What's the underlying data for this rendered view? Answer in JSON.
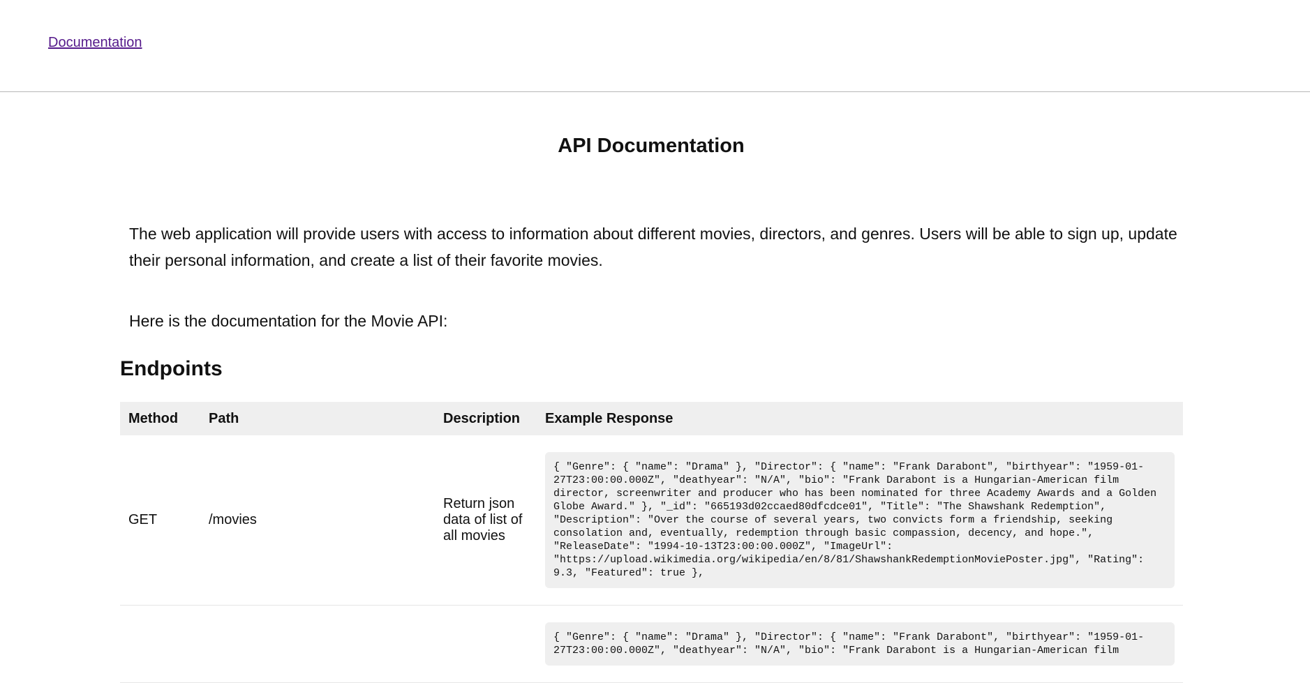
{
  "nav": {
    "documentation_link": "Documentation"
  },
  "page": {
    "title": "API Documentation",
    "intro": "The web application will provide users with access to information about different movies, directors, and genres. Users will be able to sign up, update their personal information, and create a list of their favorite movies.",
    "lead": "Here is the documentation for the Movie API:",
    "section_heading": "Endpoints"
  },
  "table": {
    "headers": [
      "Method",
      "Path",
      "Description",
      "Example Response"
    ],
    "rows": [
      {
        "method": "GET",
        "path": "/movies",
        "description": "Return json data of list of all movies",
        "example": "{ \"Genre\": { \"name\": \"Drama\" }, \"Director\": { \"name\": \"Frank Darabont\", \"birthyear\": \"1959-01-27T23:00:00.000Z\", \"deathyear\": \"N/A\", \"bio\": \"Frank Darabont is a Hungarian-American film director, screenwriter and producer who has been nominated for three Academy Awards and a Golden Globe Award.\" }, \"_id\": \"665193d02ccaed80dfcdce01\", \"Title\": \"The Shawshank Redemption\", \"Description\": \"Over the course of several years, two convicts form a friendship, seeking consolation and, eventually, redemption through basic compassion, decency, and hope.\", \"ReleaseDate\": \"1994-10-13T23:00:00.000Z\", \"ImageUrl\": \"https://upload.wikimedia.org/wikipedia/en/8/81/ShawshankRedemptionMoviePoster.jpg\", \"Rating\": 9.3, \"Featured\": true },"
      },
      {
        "method": "",
        "path": "",
        "description": "",
        "example": "{ \"Genre\": { \"name\": \"Drama\" }, \"Director\": { \"name\": \"Frank Darabont\", \"birthyear\": \"1959-01-27T23:00:00.000Z\", \"deathyear\": \"N/A\", \"bio\": \"Frank Darabont is a Hungarian-American film"
      }
    ]
  }
}
